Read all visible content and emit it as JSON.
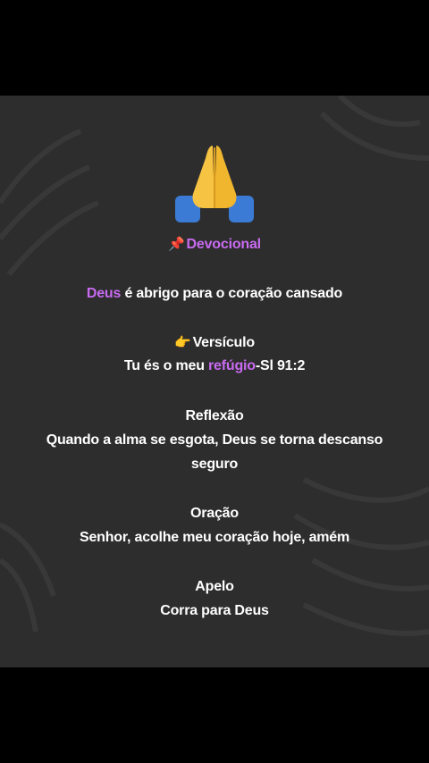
{
  "colors": {
    "accent": "#c86bf0",
    "card": "#2d2d2d",
    "text": "#ffffff"
  },
  "icons": {
    "top": "praying-hands-icon",
    "pin": "pushpin-icon",
    "point": "pointing-right-icon"
  },
  "devotional": {
    "pin_emoji": "📌",
    "title": "Devocional",
    "headline_accent": "Deus",
    "headline_rest": " é abrigo para o coração cansado",
    "point_emoji": "👉",
    "verse_label": "Versículo",
    "verse_prefix": "Tu és o meu ",
    "verse_accent": "refúgio",
    "verse_ref": "-Sl 91:2",
    "reflection_label": "Reflexão",
    "reflection_line1": "Quando a alma se esgota, Deus se torna descanso",
    "reflection_line2": "seguro",
    "prayer_label": "Oração",
    "prayer_text": "Senhor, acolhe meu coração hoje, amém",
    "appeal_label": "Apelo",
    "appeal_text": "Corra para Deus"
  }
}
